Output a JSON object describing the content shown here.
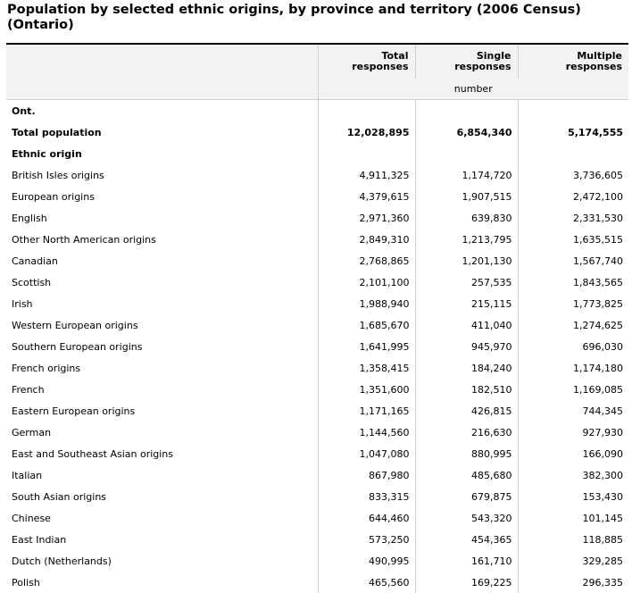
{
  "title": "Population by selected ethnic origins, by province and territory (2006 Census) (Ontario)",
  "columns": [
    "Total responses",
    "Single responses",
    "Multiple responses"
  ],
  "units": "number",
  "geo_label": "Ont.",
  "total": {
    "label": "Total population",
    "values": [
      "12,028,895",
      "6,854,340",
      "5,174,555"
    ]
  },
  "section_label": "Ethnic origin",
  "rows": [
    {
      "label": "British Isles origins",
      "values": [
        "4,911,325",
        "1,174,720",
        "3,736,605"
      ]
    },
    {
      "label": "European origins",
      "values": [
        "4,379,615",
        "1,907,515",
        "2,472,100"
      ]
    },
    {
      "label": "English",
      "values": [
        "2,971,360",
        "639,830",
        "2,331,530"
      ]
    },
    {
      "label": "Other North American origins",
      "values": [
        "2,849,310",
        "1,213,795",
        "1,635,515"
      ]
    },
    {
      "label": "Canadian",
      "values": [
        "2,768,865",
        "1,201,130",
        "1,567,740"
      ]
    },
    {
      "label": "Scottish",
      "values": [
        "2,101,100",
        "257,535",
        "1,843,565"
      ]
    },
    {
      "label": "Irish",
      "values": [
        "1,988,940",
        "215,115",
        "1,773,825"
      ]
    },
    {
      "label": "Western European origins",
      "values": [
        "1,685,670",
        "411,040",
        "1,274,625"
      ]
    },
    {
      "label": "Southern European origins",
      "values": [
        "1,641,995",
        "945,970",
        "696,030"
      ]
    },
    {
      "label": "French origins",
      "values": [
        "1,358,415",
        "184,240",
        "1,174,180"
      ]
    },
    {
      "label": "French",
      "values": [
        "1,351,600",
        "182,510",
        "1,169,085"
      ]
    },
    {
      "label": "Eastern European origins",
      "values": [
        "1,171,165",
        "426,815",
        "744,345"
      ]
    },
    {
      "label": "German",
      "values": [
        "1,144,560",
        "216,630",
        "927,930"
      ]
    },
    {
      "label": "East and Southeast Asian origins",
      "values": [
        "1,047,080",
        "880,995",
        "166,090"
      ]
    },
    {
      "label": "Italian",
      "values": [
        "867,980",
        "485,680",
        "382,300"
      ]
    },
    {
      "label": "South Asian origins",
      "values": [
        "833,315",
        "679,875",
        "153,430"
      ]
    },
    {
      "label": "Chinese",
      "values": [
        "644,460",
        "543,320",
        "101,145"
      ]
    },
    {
      "label": "East Indian",
      "values": [
        "573,250",
        "454,365",
        "118,885"
      ]
    },
    {
      "label": "Dutch (Netherlands)",
      "values": [
        "490,995",
        "161,710",
        "329,285"
      ]
    },
    {
      "label": "Polish",
      "values": [
        "465,560",
        "169,225",
        "296,335"
      ]
    }
  ]
}
